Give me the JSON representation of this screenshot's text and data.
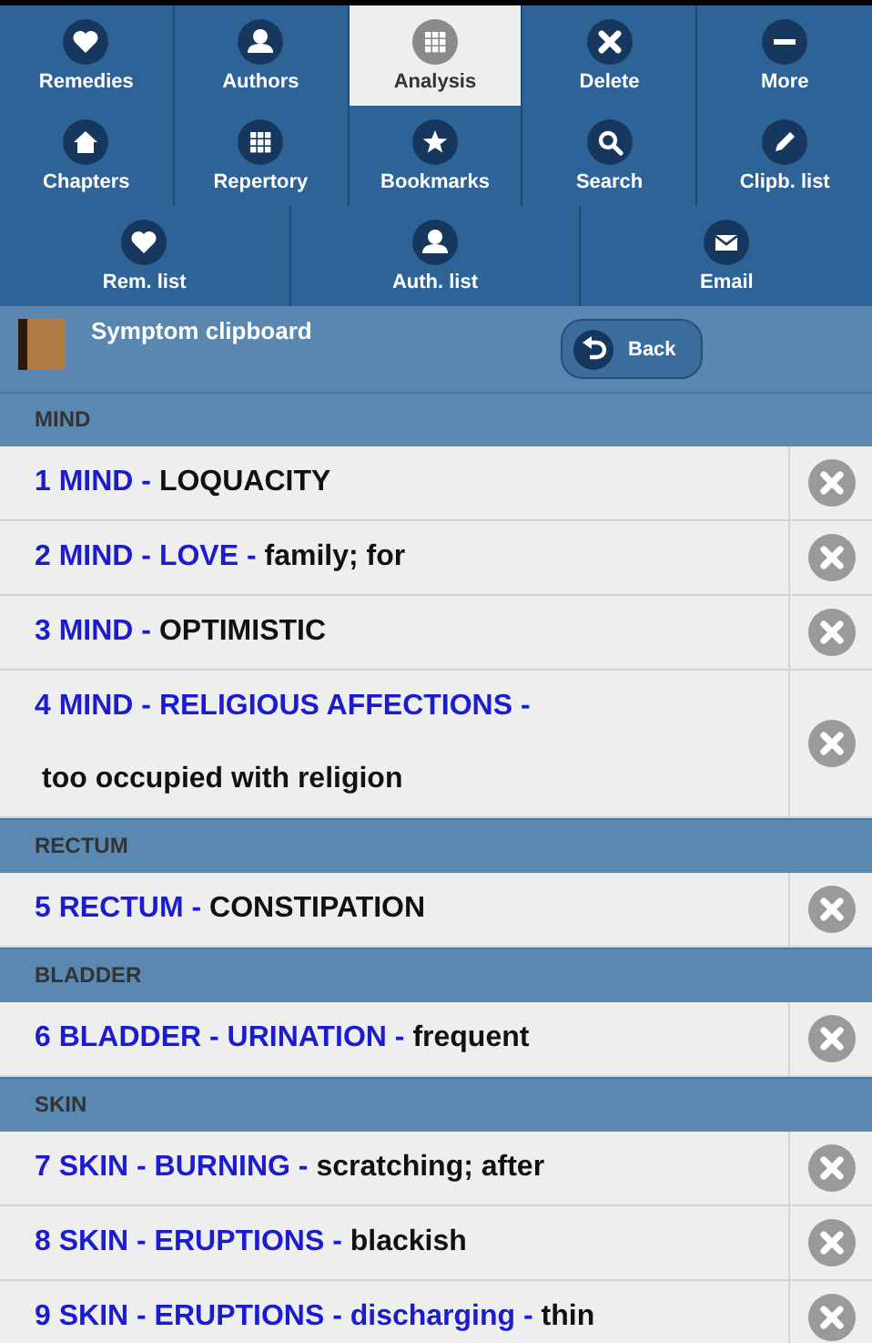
{
  "menu_rows": [
    {
      "items": [
        {
          "label": "Remedies",
          "selected": false
        },
        {
          "label": "Authors",
          "selected": false
        },
        {
          "label": "Analysis",
          "selected": true
        },
        {
          "label": "Delete",
          "selected": false
        },
        {
          "label": "More",
          "selected": false
        }
      ]
    },
    {
      "items": [
        {
          "label": "Chapters",
          "selected": false
        },
        {
          "label": "Repertory",
          "selected": false
        },
        {
          "label": "Bookmarks",
          "selected": false
        },
        {
          "label": "Search",
          "selected": false
        },
        {
          "label": "Clipb. list",
          "selected": false
        }
      ]
    },
    {
      "items": [
        {
          "label": "Rem. list",
          "selected": false
        },
        {
          "label": "Auth. list",
          "selected": false
        },
        {
          "label": "Email",
          "selected": false
        }
      ]
    }
  ],
  "header": {
    "title": "Symptom clipboard",
    "back_button": "Back"
  },
  "sections": [
    {
      "heading": "MIND",
      "symptoms": [
        {
          "path": "1 MIND -",
          "detail": "LOQUACITY"
        },
        {
          "path": "2 MIND - LOVE -",
          "detail": "family; for"
        },
        {
          "path": "3 MIND -",
          "detail": "OPTIMISTIC"
        },
        {
          "path": "4 MIND - RELIGIOUS AFFECTIONS -",
          "detail_line": "too occupied with religion"
        }
      ]
    },
    {
      "heading": "RECTUM",
      "symptoms": [
        {
          "path": "5 RECTUM -",
          "detail": "CONSTIPATION"
        }
      ]
    },
    {
      "heading": "BLADDER",
      "symptoms": [
        {
          "path": "6 BLADDER - URINATION -",
          "detail": "frequent"
        }
      ]
    },
    {
      "heading": "SKIN",
      "symptoms": [
        {
          "path": "7 SKIN - BURNING -",
          "detail": "scratching; after"
        },
        {
          "path": "8 SKIN - ERUPTIONS -",
          "detail": "blackish"
        },
        {
          "path": "9 SKIN - ERUPTIONS - discharging -",
          "detail": "thin"
        }
      ]
    }
  ]
}
